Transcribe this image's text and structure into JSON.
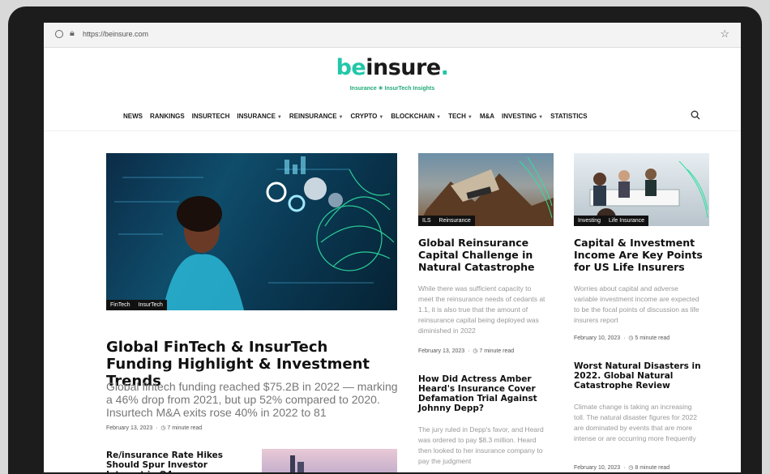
{
  "browser": {
    "url": "https://beinsure.com"
  },
  "site": {
    "logo_be": "be",
    "logo_rest": "insure",
    "logo_dot": ".",
    "tagline": "Insurance ✳ InsurTech Insights"
  },
  "nav": {
    "items": [
      {
        "label": "NEWS",
        "caret": false
      },
      {
        "label": "RANKINGS",
        "caret": false
      },
      {
        "label": "INSURTECH",
        "caret": false
      },
      {
        "label": "INSURANCE",
        "caret": true
      },
      {
        "label": "REINSURANCE",
        "caret": true
      },
      {
        "label": "CRYPTO",
        "caret": true
      },
      {
        "label": "BLOCKCHAIN",
        "caret": true
      },
      {
        "label": "TECH",
        "caret": true
      },
      {
        "label": "M&A",
        "caret": false
      },
      {
        "label": "INVESTING",
        "caret": true
      },
      {
        "label": "STATISTICS",
        "caret": false
      }
    ]
  },
  "featured": {
    "tags": [
      "FinTech",
      "InsurTech"
    ],
    "title": "Global FinTech & InsurTech Funding Highlight & Investment Trends",
    "excerpt": "Global fintech funding reached $75.2B in 2022 — marking a 46% drop from 2021, but up 52% compared to 2020. Insurtech M&A exits rose 40% in 2022 to 81",
    "date": "February 13, 2023",
    "read": "7 minute read"
  },
  "bottom_left": {
    "title": "Re/insurance Rate Hikes Should Spur Investor Interest in Q4"
  },
  "col2": {
    "a1": {
      "tags": [
        "ILS",
        "Reinsurance"
      ],
      "title": "Global Reinsurance Capital Challenge in Natural Catastrophe",
      "excerpt": "While there was sufficient capacity to meet the reinsurance needs of cedants at 1.1, it is also true that the amount of reinsurance capital being deployed was diminished in 2022",
      "date": "February 13, 2023",
      "read": "7 minute read"
    },
    "a2": {
      "title": "How Did Actress Amber Heard's Insurance Cover Defamation Trial Against Johnny Depp?",
      "excerpt": "The jury ruled in Depp's favor, and Heard was ordered to pay $8.3 million. Heard then looked to her insurance company to pay the judgment"
    }
  },
  "col3": {
    "a1": {
      "tags": [
        "Investing",
        "Life Insurance"
      ],
      "title": "Capital & Investment Income Are Key Points for US Life Insurers",
      "excerpt": "Worries about capital and adverse variable investment income are expected to be the focal points of discussion as life insurers report",
      "date": "February 10, 2023",
      "read": "5 minute read"
    },
    "a2": {
      "title": "Worst Natural Disasters in 2022. Global Natural Catastrophe Review",
      "excerpt": "Climate change is taking an increasing toll. The natural disaster figures for 2022 are dominated by events that are more intense or are occurring more frequently",
      "date": "February 10, 2023",
      "read": "8 minute read"
    }
  },
  "colors": {
    "brand": "#21c7a8",
    "text": "#111111",
    "muted": "#999999"
  }
}
